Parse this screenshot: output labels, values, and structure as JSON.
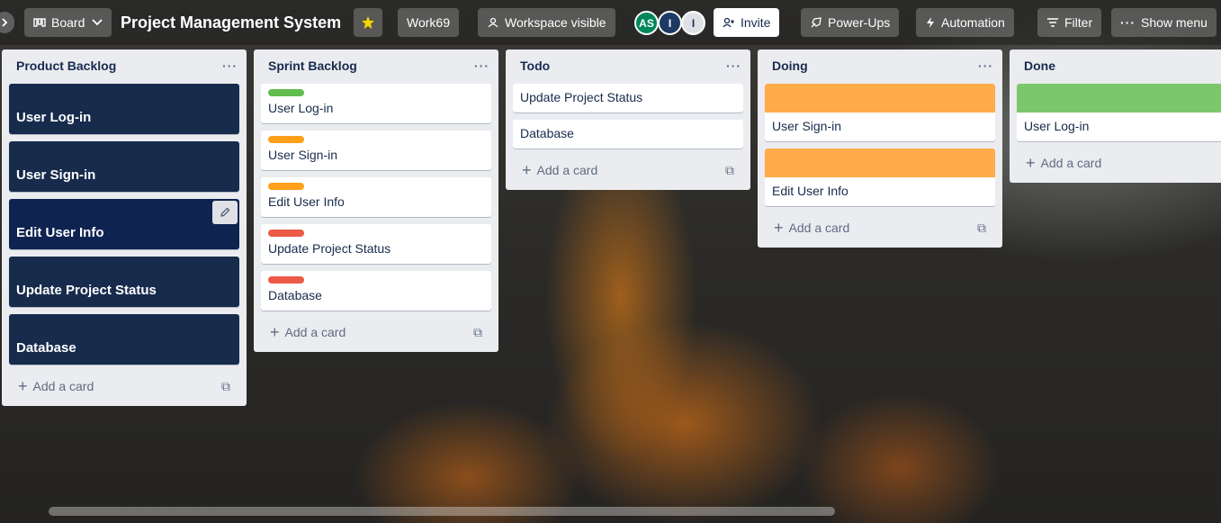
{
  "header": {
    "view_label": "Board",
    "board_title": "Project Management System",
    "workspace_label": "Work69",
    "visibility_label": "Workspace visible",
    "members": [
      {
        "initials": "AS",
        "color": "#00875a"
      },
      {
        "initials": "I",
        "color": "#1c3a63"
      },
      {
        "initials": "I",
        "color": "#dfe1e6"
      }
    ],
    "invite_label": "Invite",
    "powerups_label": "Power-Ups",
    "automation_label": "Automation",
    "filter_label": "Filter",
    "show_menu_label": "Show menu"
  },
  "lists": [
    {
      "title": "Product Backlog",
      "cards": [
        {
          "text": "User Log-in"
        },
        {
          "text": "User Sign-in"
        },
        {
          "text": "Edit User Info"
        },
        {
          "text": "Update Project Status"
        },
        {
          "text": "Database"
        }
      ],
      "add_label": "Add a card"
    },
    {
      "title": "Sprint Backlog",
      "cards": [
        {
          "text": "User Log-in",
          "label_color": "#61bd4f"
        },
        {
          "text": "User Sign-in",
          "label_color": "#ff9f1a"
        },
        {
          "text": "Edit User Info",
          "label_color": "#ff9f1a"
        },
        {
          "text": "Update Project Status",
          "label_color": "#eb5a46"
        },
        {
          "text": "Database",
          "label_color": "#eb5a46"
        }
      ],
      "add_label": "Add a card"
    },
    {
      "title": "Todo",
      "cards": [
        {
          "text": "Update Project Status"
        },
        {
          "text": "Database"
        }
      ],
      "add_label": "Add a card"
    },
    {
      "title": "Doing",
      "cards": [
        {
          "text": "User Sign-in",
          "cover_color": "#ffab4a"
        },
        {
          "text": "Edit User Info",
          "cover_color": "#ffab4a"
        }
      ],
      "add_label": "Add a card"
    },
    {
      "title": "Done",
      "cards": [
        {
          "text": "User Log-in",
          "cover_color": "#7bc86c"
        }
      ],
      "add_label": "Add a card"
    }
  ],
  "icons": {
    "collapse": "chevron-right-icon",
    "board": "board-icon",
    "star": "star-icon",
    "visibility": "people-icon",
    "invite": "person-add-icon",
    "powerups": "rocket-icon",
    "automation": "bolt-icon",
    "filter": "filter-icon",
    "menu": "more-icon",
    "card_edit": "pencil-icon",
    "template": "template-icon"
  },
  "colors": {
    "star_active": "#f2d600",
    "backlog_card": "#172b4d"
  }
}
